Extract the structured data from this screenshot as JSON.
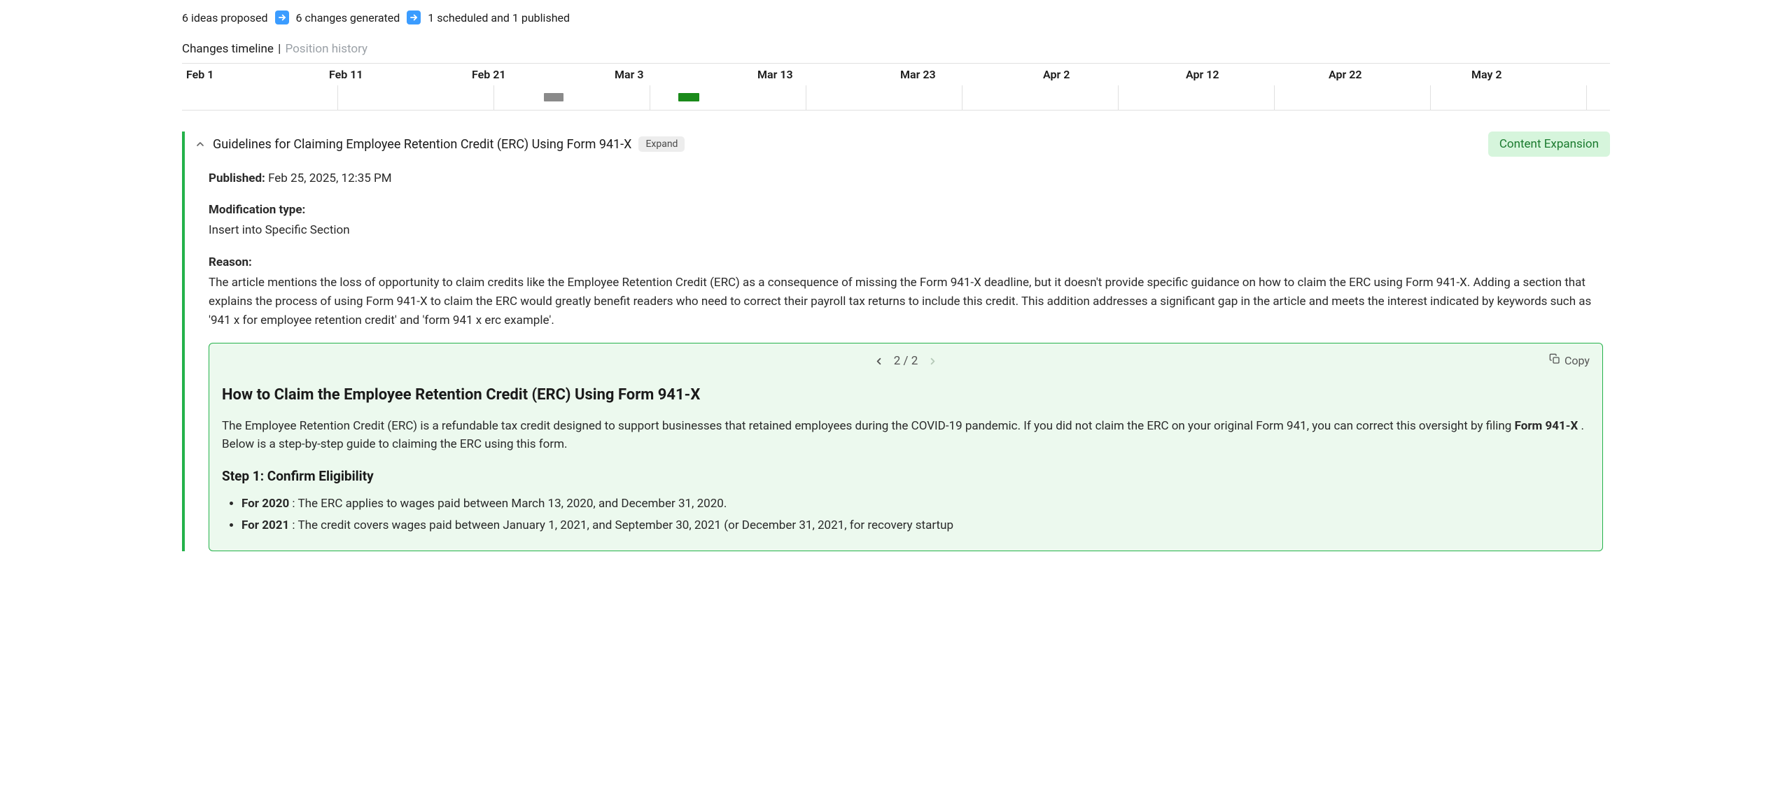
{
  "summary": {
    "ideas": "6 ideas proposed",
    "changes": "6 changes generated",
    "scheduled": "1 scheduled and 1 published"
  },
  "tabs": {
    "active": "Changes timeline",
    "sep": "|",
    "inactive": "Position history"
  },
  "timeline": {
    "dates": [
      "Feb 1",
      "Feb 11",
      "Feb 21",
      "Mar 3",
      "Mar 13",
      "Mar 23",
      "Apr 2",
      "Apr 12",
      "Apr 22",
      "May 2"
    ]
  },
  "card": {
    "title": "Guidelines for Claiming Employee Retention Credit (ERC) Using Form 941-X",
    "expand": "Expand",
    "badge": "Content Expansion",
    "published_label": "Published:",
    "published_value": "Feb 25, 2025, 12:35 PM",
    "mod_label": "Modification type:",
    "mod_value": "Insert into Specific Section",
    "reason_label": "Reason:",
    "reason_text": "The article mentions the loss of opportunity to claim credits like the Employee Retention Credit (ERC) as a consequence of missing the Form 941-X deadline, but it doesn't provide specific guidance on how to claim the ERC using Form 941-X. Adding a section that explains the process of using Form 941-X to claim the ERC would greatly benefit readers who need to correct their payroll tax returns to include this credit. This addition addresses a significant gap in the article and meets the interest indicated by keywords such as '941 x for employee retention credit' and 'form 941 x erc example'."
  },
  "panel": {
    "pager": "2 / 2",
    "copy": "Copy",
    "h2": "How to Claim the Employee Retention Credit (ERC) Using Form 941-X",
    "intro_a": "The Employee Retention Credit (ERC) is a refundable tax credit designed to support businesses that retained employees during the COVID-19 pandemic. If you did not claim the ERC on your original Form 941, you can correct this oversight by filing ",
    "intro_bold": "Form 941-X",
    "intro_b": " . Below is a step-by-step guide to claiming the ERC using this form.",
    "step1_h": "Step 1: Confirm Eligibility",
    "li1_bold": "For 2020",
    "li1_text": " : The ERC applies to wages paid between March 13, 2020, and December 31, 2020.",
    "li2_bold": "For 2021",
    "li2_text": " : The credit covers wages paid between January 1, 2021, and September 30, 2021 (or December 31, 2021, for recovery startup"
  }
}
